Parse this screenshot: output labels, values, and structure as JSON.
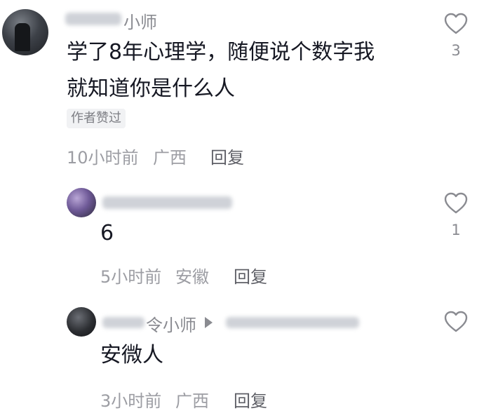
{
  "comments": [
    {
      "username_visible": "小师",
      "text_line1": "学了8年心理学，随便说个数字我",
      "text_line2": "就知道你是什么人",
      "tag": "作者赞过",
      "time": "10小时前",
      "location": "广西",
      "reply_label": "回复",
      "like_count": "3"
    },
    {
      "text": "6",
      "time": "5小时前",
      "location": "安徽",
      "reply_label": "回复",
      "like_count": "1"
    },
    {
      "username_visible": "令小师",
      "text": "安微人",
      "time": "3小时前",
      "location": "广西",
      "reply_label": "回复"
    }
  ],
  "icons": {
    "like": "heart-outline-icon",
    "reply_to": "triangle-right-icon"
  },
  "colors": {
    "text": "#161823",
    "meta": "#9c9da3",
    "icon": "#8a8b91"
  }
}
